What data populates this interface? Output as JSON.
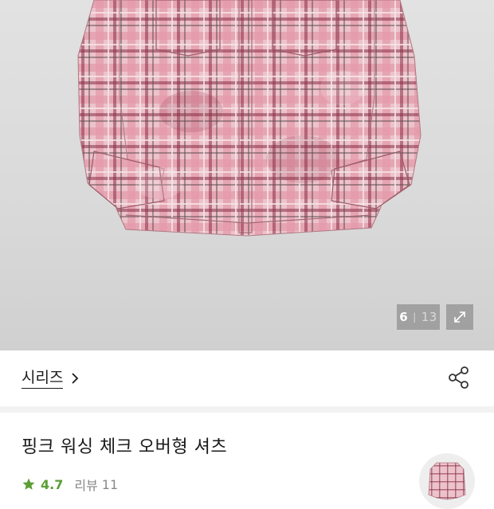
{
  "gallery": {
    "current_index": "6",
    "separator": "|",
    "total": "13",
    "expand_icon": "expand-arrow-icon"
  },
  "series": {
    "label": "시리즈",
    "chevron_icon": "chevron-right-icon",
    "share_icon": "share-icon"
  },
  "product": {
    "title": "핑크 워싱 체크 오버형 셔츠",
    "rating_icon": "star-icon",
    "rating": "4.7",
    "review_label": "리뷰",
    "review_count": "11"
  },
  "colors": {
    "rating_green": "#5a9e35",
    "shirt_pink": "#e6a6b2",
    "check_burgundy": "#8a2f45"
  }
}
